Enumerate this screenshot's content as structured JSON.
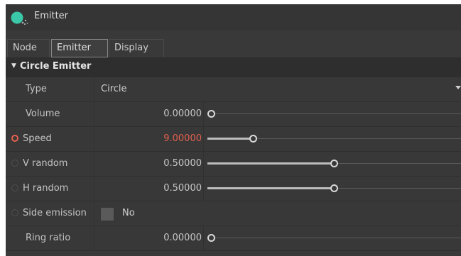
{
  "window": {
    "title": "Emitter",
    "icon": "emitter-node-icon",
    "accent": "#3bc8a8"
  },
  "tabs": [
    {
      "label": "Node",
      "active": false
    },
    {
      "label": "Emitter",
      "active": true
    },
    {
      "label": "Display",
      "active": false
    }
  ],
  "section": {
    "label": "Circle Emitter",
    "expanded": true
  },
  "colors": {
    "animated": "#e2604f",
    "panel": "#393939"
  },
  "rows": {
    "type": {
      "label": "Type",
      "value": "Circle"
    },
    "volume": {
      "label": "Volume",
      "value": "0.00000",
      "slider_fraction": 0.0
    },
    "speed": {
      "label": "Speed",
      "value": "9.00000",
      "slider_fraction": 0.18,
      "animated": true
    },
    "v_random": {
      "label": "V random",
      "value": "0.50000",
      "slider_fraction": 0.5
    },
    "h_random": {
      "label": "H random",
      "value": "0.50000",
      "slider_fraction": 0.5
    },
    "side_emission": {
      "label": "Side emission",
      "value": "No"
    },
    "ring_ratio": {
      "label": "Ring ratio",
      "value": "0.00000",
      "slider_fraction": 0.0
    }
  }
}
